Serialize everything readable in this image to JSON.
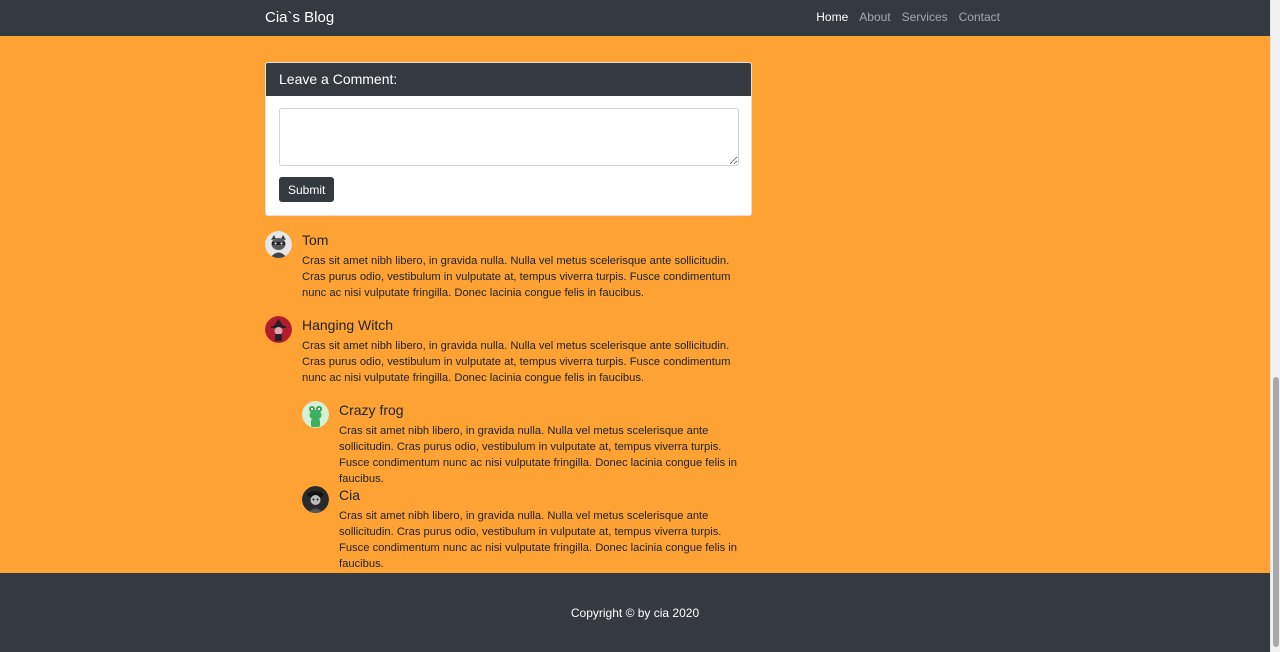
{
  "navbar": {
    "brand": "Cia`s Blog",
    "links": [
      {
        "label": "Home",
        "active": true
      },
      {
        "label": "About",
        "active": false
      },
      {
        "label": "Services",
        "active": false
      },
      {
        "label": "Contact",
        "active": false
      }
    ]
  },
  "comment_form": {
    "title": "Leave a Comment:",
    "textarea_value": "",
    "submit_label": "Submit"
  },
  "comments": [
    {
      "name": "Tom",
      "avatar": "raccoon-avatar-icon",
      "text": "Cras sit amet nibh libero, in gravida nulla. Nulla vel metus scelerisque ante sollicitudin. Cras purus odio, vestibulum in vulputate at, tempus viverra turpis. Fusce condimentum nunc ac nisi vulputate fringilla. Donec lacinia congue felis in faucibus."
    },
    {
      "name": "Hanging Witch",
      "avatar": "witch-avatar-icon",
      "text": "Cras sit amet nibh libero, in gravida nulla. Nulla vel metus scelerisque ante sollicitudin. Cras purus odio, vestibulum in vulputate at, tempus viverra turpis. Fusce condimentum nunc ac nisi vulputate fringilla. Donec lacinia congue felis in faucibus.",
      "replies": [
        {
          "name": "Crazy frog",
          "avatar": "frog-avatar-icon",
          "text": "Cras sit amet nibh libero, in gravida nulla. Nulla vel metus scelerisque ante sollicitudin. Cras purus odio, vestibulum in vulputate at, tempus viverra turpis. Fusce condimentum nunc ac nisi vulputate fringilla. Donec lacinia congue felis in faucibus."
        },
        {
          "name": "Cia",
          "avatar": "cia-avatar-icon",
          "text": "Cras sit amet nibh libero, in gravida nulla. Nulla vel metus scelerisque ante sollicitudin. Cras purus odio, vestibulum in vulputate at, tempus viverra turpis. Fusce condimentum nunc ac nisi vulputate fringilla. Donec lacinia congue felis in faucibus."
        }
      ]
    }
  ],
  "footer": {
    "copyright": "Copyright © by cia 2020"
  },
  "colors": {
    "page_background": "#ffa234",
    "navbar": "#343a40",
    "footer": "#343a40",
    "card": "#ffffff"
  }
}
